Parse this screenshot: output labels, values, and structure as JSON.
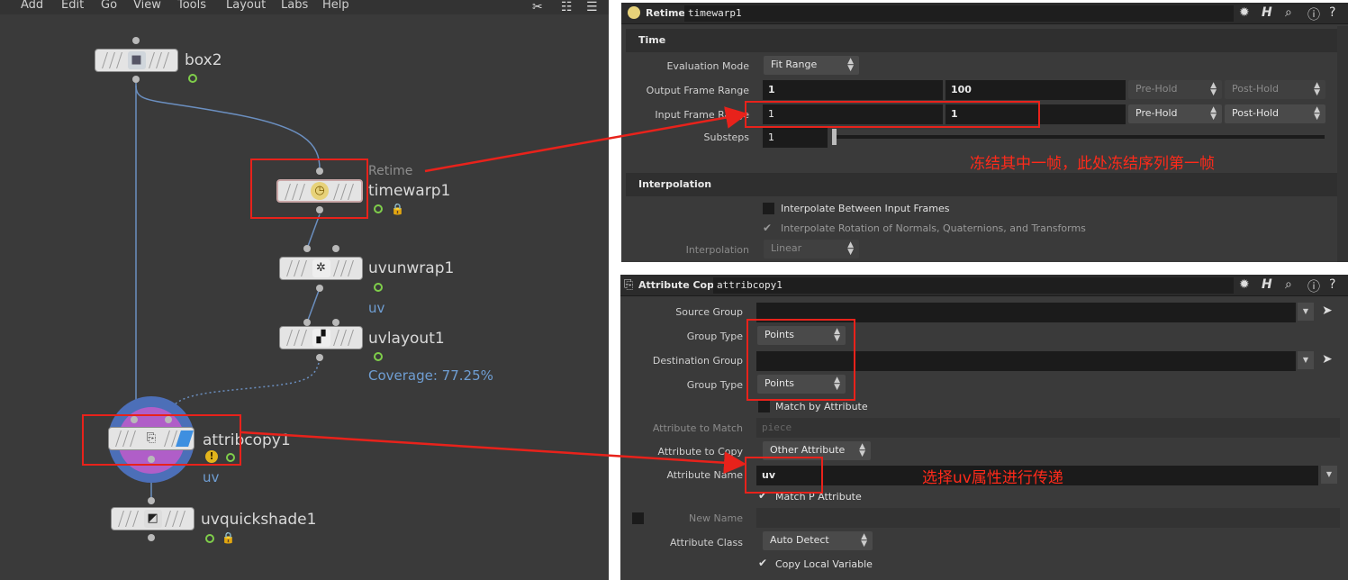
{
  "menu": {
    "items": [
      "Add",
      "Edit",
      "Go",
      "View",
      "Tools",
      "Layout",
      "Labs",
      "Help"
    ]
  },
  "network": {
    "nodes": {
      "box2": {
        "name": "box2"
      },
      "timewarp": {
        "type_label": "Retime",
        "name": "timewarp1"
      },
      "uvunwrap": {
        "name": "uvunwrap1",
        "sub": "uv"
      },
      "uvlayout": {
        "name": "uvlayout1",
        "sub": "Coverage: 77.25%"
      },
      "attribcopy": {
        "name": "attribcopy1",
        "sub": "uv"
      },
      "uvquickshade": {
        "name": "uvquickshade1"
      }
    }
  },
  "retime_panel": {
    "type": "Retime",
    "node_name": "timewarp1",
    "section_time": "Time",
    "evaluation_mode_label": "Evaluation Mode",
    "evaluation_mode_value": "Fit Range",
    "output_frame_range_label": "Output Frame Range",
    "output_start": "1",
    "output_end": "100",
    "output_prehold": "Pre-Hold",
    "output_posthold": "Post-Hold",
    "input_frame_range_label": "Input Frame Range",
    "input_start": "1",
    "input_end": "1",
    "input_prehold": "Pre-Hold",
    "input_posthold": "Post-Hold",
    "substeps_label": "Substeps",
    "substeps_value": "1",
    "annotation": "冻结其中一帧，此处冻结序列第一帧",
    "section_interpolation": "Interpolation",
    "interp_between_label": "Interpolate Between Input Frames",
    "interp_rotation_label": "Interpolate Rotation of Normals, Quaternions, and Transforms",
    "interpolation_label": "Interpolation",
    "interpolation_value": "Linear"
  },
  "attribcopy_panel": {
    "type": "Attribute Copy",
    "node_name": "attribcopy1",
    "source_group_label": "Source Group",
    "group_type_label_1": "Group Type",
    "group_type_value_1": "Points",
    "destination_group_label": "Destination Group",
    "group_type_label_2": "Group Type",
    "group_type_value_2": "Points",
    "match_by_attribute_label": "Match by Attribute",
    "attribute_to_match_label": "Attribute to Match",
    "attribute_to_match_placeholder": "piece",
    "attribute_to_copy_label": "Attribute to Copy",
    "attribute_to_copy_value": "Other Attribute",
    "attribute_name_label": "Attribute Name",
    "attribute_name_value": "uv",
    "annotation": "选择uv属性进行传递",
    "match_p_label": "Match P Attribute",
    "new_name_label": "New Name",
    "attribute_class_label": "Attribute Class",
    "attribute_class_value": "Auto Detect",
    "copy_local_label": "Copy Local Variable"
  },
  "colors": {
    "annotation": "#e8221b",
    "network_bg": "#3a3a3a",
    "panel_bg": "#3a3a3a",
    "link": "#6f9ed3"
  }
}
